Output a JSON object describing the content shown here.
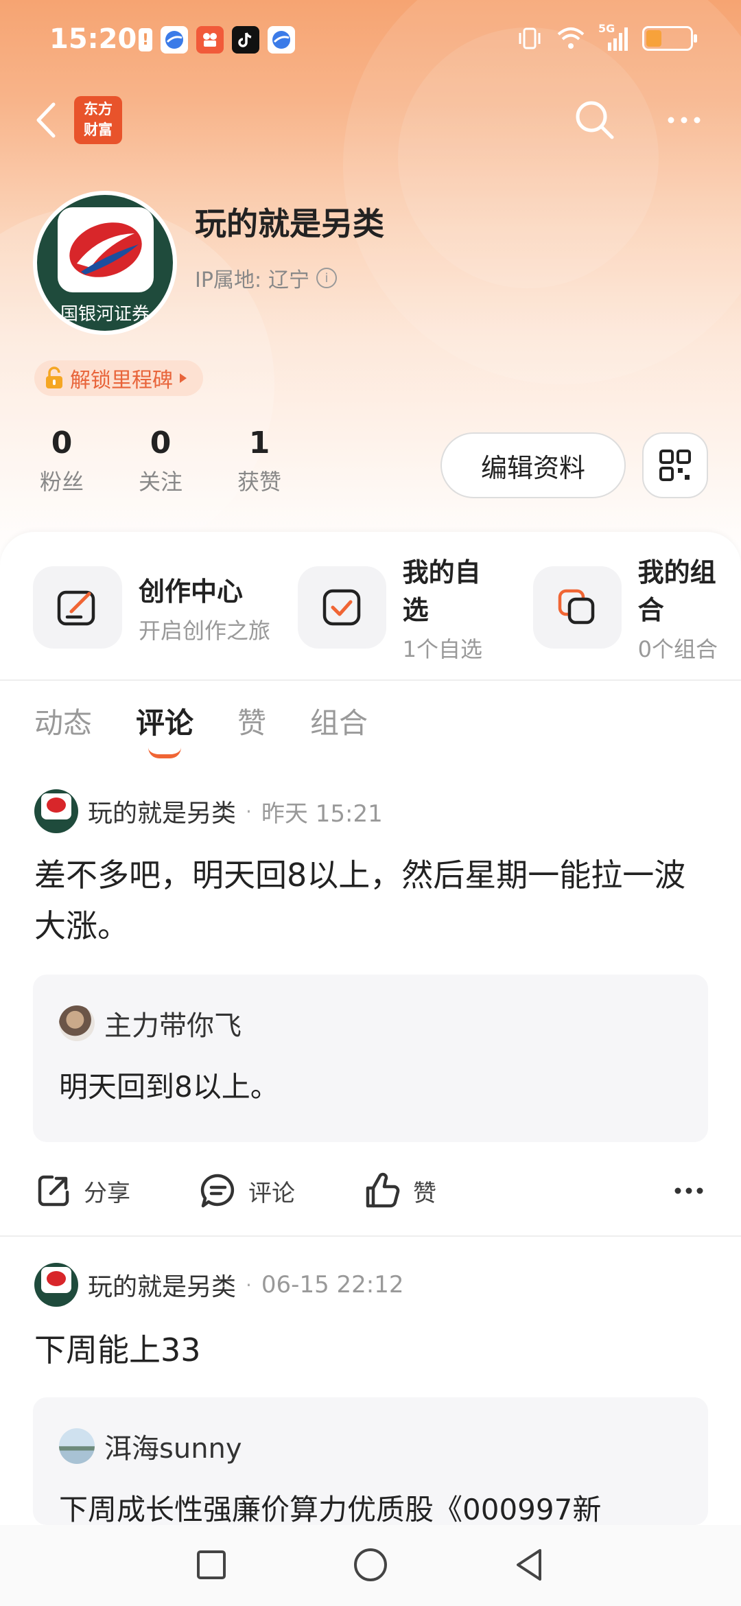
{
  "status_bar": {
    "time": "15:20",
    "alert_glyph": "!",
    "signal_label": "5G"
  },
  "nav": {
    "brand_line1": "东方",
    "brand_line2": "财富"
  },
  "profile": {
    "username": "玩的就是另类",
    "avatar_text": "国银河证券",
    "ip_label": "IP属地:",
    "ip_value": "辽宁",
    "info_glyph": "i",
    "milestone": "解锁里程碑",
    "stats": [
      {
        "value": "0",
        "label": "粉丝"
      },
      {
        "value": "0",
        "label": "关注"
      },
      {
        "value": "1",
        "label": "获赞"
      }
    ],
    "edit_label": "编辑资料"
  },
  "features": [
    {
      "title": "创作中心",
      "sub": "开启创作之旅"
    },
    {
      "title": "我的自选",
      "sub": "1个自选"
    },
    {
      "title": "我的组合",
      "sub": "0个组合"
    }
  ],
  "tabs": [
    {
      "label": "动态",
      "active": false
    },
    {
      "label": "评论",
      "active": true
    },
    {
      "label": "赞",
      "active": false
    },
    {
      "label": "组合",
      "active": false
    }
  ],
  "posts": [
    {
      "author": "玩的就是另类",
      "dot": "·",
      "time": "昨天 15:21",
      "text": "差不多吧，明天回8以上，然后星期一能拉一波大涨。",
      "quote_author": "主力带你飞",
      "quote_text": "明天回到8以上。",
      "actions": {
        "share": "分享",
        "comment": "评论",
        "like": "赞"
      }
    },
    {
      "author": "玩的就是另类",
      "dot": "·",
      "time": "06-15 22:12",
      "text": "下周能上33",
      "quote_author": "洱海sunny",
      "quote_text": "下周成长性强廉价算力优质股《000997新"
    }
  ],
  "colors": {
    "accent": "#f06534",
    "header_top": "#f6a472",
    "brand": "#e8532b"
  }
}
